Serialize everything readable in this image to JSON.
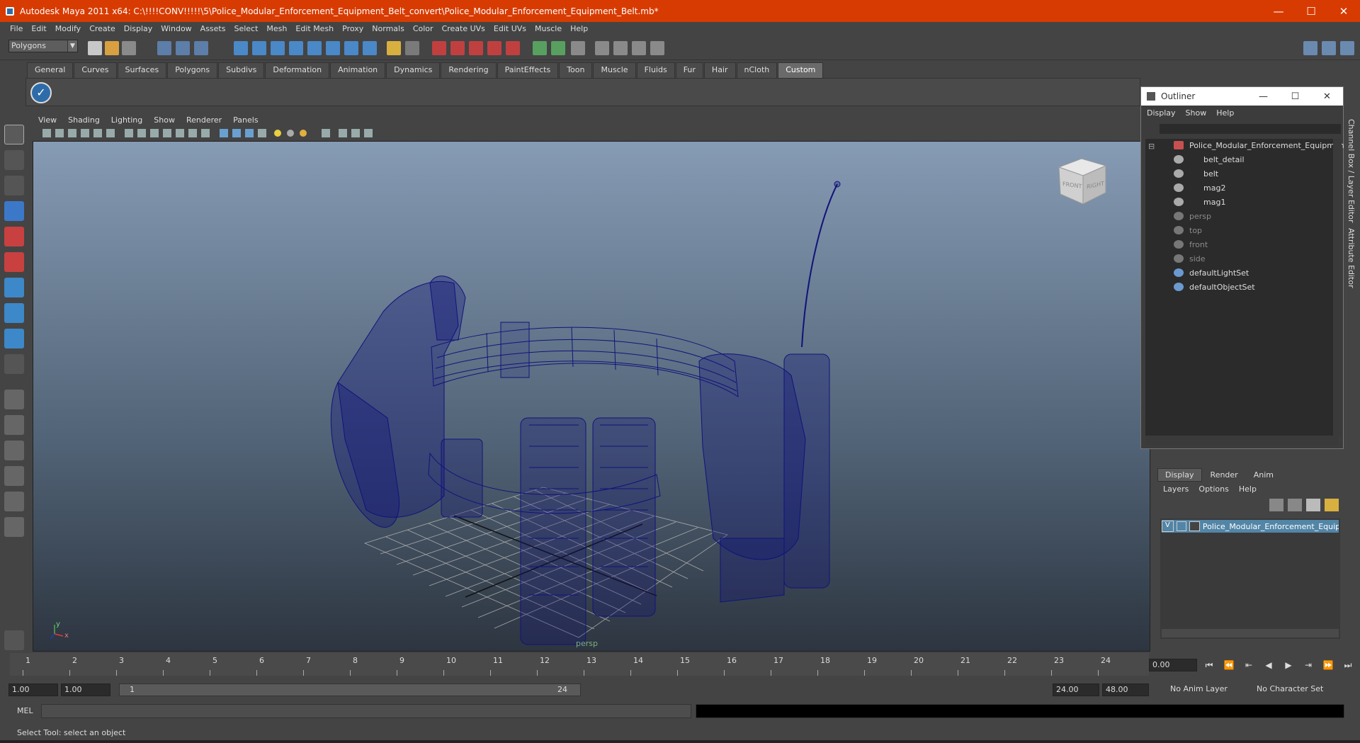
{
  "window": {
    "title": "Autodesk Maya 2011 x64: C:\\!!!!CONV!!!!!\\5\\Police_Modular_Enforcement_Equipment_Belt_convert\\Police_Modular_Enforcement_Equipment_Belt.mb*",
    "minimize": "—",
    "maximize": "☐",
    "close": "✕"
  },
  "menubar": [
    "File",
    "Edit",
    "Modify",
    "Create",
    "Display",
    "Window",
    "Assets",
    "Select",
    "Mesh",
    "Edit Mesh",
    "Proxy",
    "Normals",
    "Color",
    "Create UVs",
    "Edit UVs",
    "Muscle",
    "Help"
  ],
  "mode_selector": "Polygons",
  "shelf_tabs": [
    "General",
    "Curves",
    "Surfaces",
    "Polygons",
    "Subdivs",
    "Deformation",
    "Animation",
    "Dynamics",
    "Rendering",
    "PaintEffects",
    "Toon",
    "Muscle",
    "Fluids",
    "Fur",
    "Hair",
    "nCloth",
    "Custom"
  ],
  "active_shelf_tab": "Custom",
  "viewport": {
    "menus": [
      "View",
      "Shading",
      "Lighting",
      "Show",
      "Renderer",
      "Panels"
    ],
    "camera_label": "persp",
    "viewcube_front": "FRONT",
    "viewcube_right": "RIGHT",
    "axis_y": "y",
    "axis_x": "x"
  },
  "outliner": {
    "title": "Outliner",
    "menus": [
      "Display",
      "Show",
      "Help"
    ],
    "items": [
      {
        "label": "Police_Modular_Enforcement_Equipmen",
        "dim": false,
        "depth": 0
      },
      {
        "label": "belt_detail",
        "dim": false,
        "depth": 1
      },
      {
        "label": "belt",
        "dim": false,
        "depth": 1
      },
      {
        "label": "mag2",
        "dim": false,
        "depth": 1
      },
      {
        "label": "mag1",
        "dim": false,
        "depth": 1
      },
      {
        "label": "persp",
        "dim": true,
        "depth": 0
      },
      {
        "label": "top",
        "dim": true,
        "depth": 0
      },
      {
        "label": "front",
        "dim": true,
        "depth": 0
      },
      {
        "label": "side",
        "dim": true,
        "depth": 0
      },
      {
        "label": "defaultLightSet",
        "dim": false,
        "depth": 0
      },
      {
        "label": "defaultObjectSet",
        "dim": false,
        "depth": 0
      }
    ]
  },
  "side_tabs": [
    "Channel Box / Layer Editor",
    "Attribute Editor"
  ],
  "layer_editor": {
    "tabs": [
      "Display",
      "Render",
      "Anim"
    ],
    "active_tab": "Display",
    "menus": [
      "Layers",
      "Options",
      "Help"
    ],
    "layer": {
      "visible": "V",
      "name": "Police_Modular_Enforcement_Equipme"
    }
  },
  "timeline": {
    "ticks": [
      "1",
      "2",
      "3",
      "4",
      "5",
      "6",
      "7",
      "8",
      "9",
      "10",
      "11",
      "12",
      "13",
      "14",
      "15",
      "16",
      "17",
      "18",
      "19",
      "20",
      "21",
      "22",
      "23",
      "24"
    ],
    "current_time": "0.00"
  },
  "range": {
    "start": "1.00",
    "anim_start": "1.00",
    "slider_low": "1",
    "slider_high": "24",
    "end": "24.00",
    "anim_end": "48.00",
    "anim_layer": "No Anim Layer",
    "character_set": "No Character Set"
  },
  "command_line": {
    "label": "MEL"
  },
  "help_line": "Select Tool: select an object"
}
